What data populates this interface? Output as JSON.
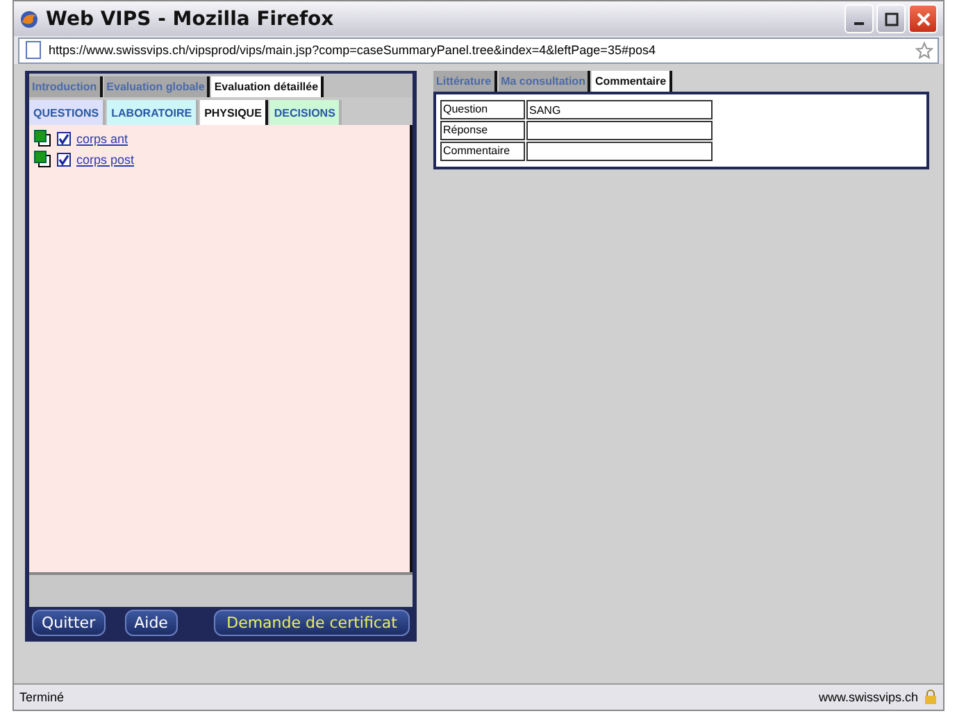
{
  "window": {
    "title": "Web VIPS - Mozilla Firefox"
  },
  "address_bar": {
    "value": "https://www.swissvips.ch/vipsprod/vips/main.jsp?comp=caseSummaryPanel.tree&index=4&leftPage=35#pos4"
  },
  "left_panel": {
    "tabs": [
      {
        "label": "Introduction",
        "selected": false
      },
      {
        "label": "Evaluation globale",
        "selected": false
      },
      {
        "label": "Evaluation détaillée",
        "selected": true
      }
    ],
    "sub_tabs": [
      {
        "label": "QUESTIONS",
        "selected": false,
        "color": "#dde0fa"
      },
      {
        "label": "LABORATOIRE",
        "selected": false,
        "color": "#ccf6f8"
      },
      {
        "label": "PHYSIQUE",
        "selected": true,
        "color": "#ffffff"
      },
      {
        "label": "DECISIONS",
        "selected": false,
        "color": "#ccf8d6"
      }
    ],
    "tree": [
      {
        "label": "corps ant",
        "checked": true
      },
      {
        "label": "corps post",
        "checked": true
      }
    ],
    "buttons": [
      {
        "label": "Quitter"
      },
      {
        "label": "Aide"
      },
      {
        "label": "Demande de certificat"
      }
    ]
  },
  "right_panel": {
    "tabs": [
      {
        "label": "Littérature",
        "selected": false
      },
      {
        "label": "Ma consultation",
        "selected": false
      },
      {
        "label": "Commentaire",
        "selected": true
      }
    ],
    "form": [
      {
        "label": "Question",
        "value": "SANG"
      },
      {
        "label": "Réponse"
      },
      {
        "label": "Commentaire"
      }
    ]
  },
  "status_bar": {
    "text": "Terminé",
    "site": "www.swissvips.ch"
  }
}
